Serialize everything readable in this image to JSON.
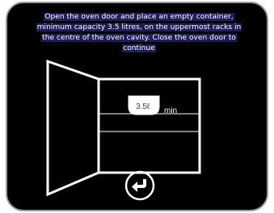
{
  "instruction": {
    "line1": "Open the oven door and place an empty container,",
    "line2": "minimum capacity 3.5 litres, on the uppermost racks in",
    "line3": "the centre of the oven cavity. Close the oven door to",
    "line4": "continue"
  },
  "container": {
    "amount": "3.5ℓ",
    "unit": "min"
  },
  "icons": {
    "back": "back-arrow-icon"
  },
  "colors": {
    "background": "#000000",
    "foreground": "#ffffff",
    "text_highlight": "#1e1e5a",
    "frame_border": "#9a9a9a"
  }
}
